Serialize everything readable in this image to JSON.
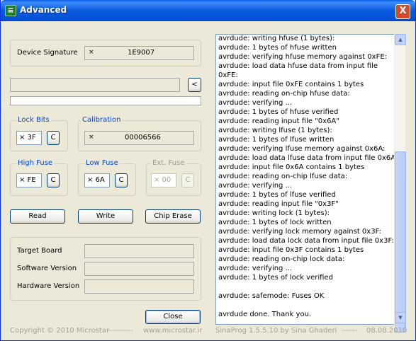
{
  "window": {
    "title": "Advanced",
    "icon": "chip-icon",
    "close_glyph": "X"
  },
  "device": {
    "label": "Device Signature",
    "x": "×",
    "value": "1E9007"
  },
  "nav": {
    "back_glyph": "<"
  },
  "lock_bits": {
    "title": "Lock Bits",
    "value": "× 3F",
    "c": "C"
  },
  "calibration": {
    "title": "Calibration",
    "x": "×",
    "value": "00006566"
  },
  "high_fuse": {
    "title": "High Fuse",
    "value": "× FE",
    "c": "C"
  },
  "low_fuse": {
    "title": "Low Fuse",
    "value": "× 6A",
    "c": "C"
  },
  "ext_fuse": {
    "title": "Ext. Fuse",
    "value": "× 00",
    "c": "C"
  },
  "buttons": {
    "read": "Read",
    "write": "Write",
    "chip_erase": "Chip Erase",
    "close": "Close"
  },
  "info": {
    "target_board": "Target Board",
    "software_version": "Software Version",
    "hardware_version": "Hardware Version"
  },
  "log": {
    "lines": [
      "avrdude: writing hfuse (1 bytes):",
      "avrdude: 1 bytes of hfuse written",
      "avrdude: verifying hfuse memory against 0xFE:",
      "avrdude: load data hfuse data from input file",
      "0xFE:",
      "avrdude: input file 0xFE contains 1 bytes",
      "avrdude: reading on-chip hfuse data:",
      "avrdude: verifying ...",
      "avrdude: 1 bytes of hfuse verified",
      "avrdude: reading input file \"0x6A\"",
      "avrdude: writing lfuse (1 bytes):",
      "avrdude: 1 bytes of lfuse written",
      "avrdude: verifying lfuse memory against 0x6A:",
      "avrdude: load data lfuse data from input file 0x6A:",
      "avrdude: input file 0x6A contains 1 bytes",
      "avrdude: reading on-chip lfuse data:",
      "avrdude: verifying ...",
      "avrdude: 1 bytes of lfuse verified",
      "avrdude: reading input file \"0x3F\"",
      "avrdude: writing lock (1 bytes):",
      "avrdude: 1 bytes of lock written",
      "avrdude: verifying lock memory against 0x3F:",
      "avrdude: load data lock data from input file 0x3F:",
      "avrdude: input file 0x3F contains 1 bytes",
      "avrdude: reading on-chip lock data:",
      "avrdude: verifying ...",
      "avrdude: 1 bytes of lock verified",
      "",
      "avrdude: safemode: Fuses OK",
      "",
      "avrdude done.  Thank you."
    ]
  },
  "scrollbar": {
    "up_glyph": "▲",
    "down_glyph": "▼"
  },
  "status": {
    "copyright": "Copyright © 2010 Microstar",
    "sep1": "----------",
    "website": "www.microstar.ir",
    "app": "SinaProg 1.5.5.10  by  Sina Ghaderi",
    "sep2": "------",
    "date": "08.08.2010"
  }
}
